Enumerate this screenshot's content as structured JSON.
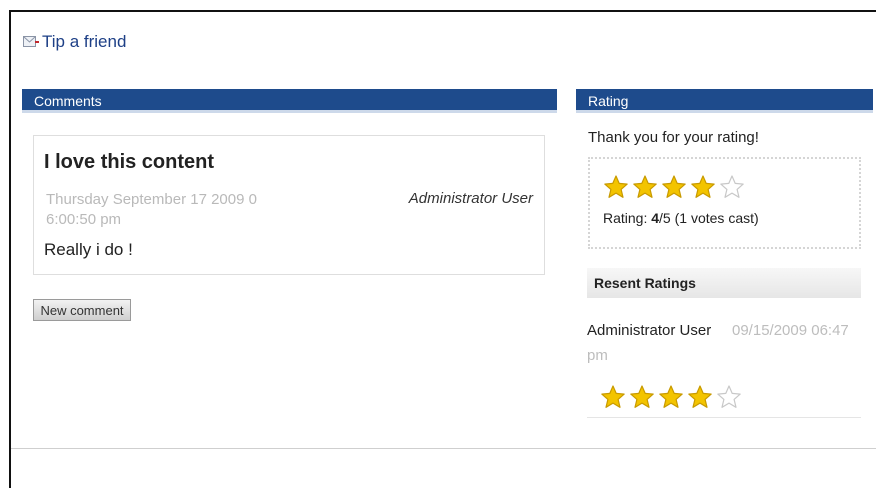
{
  "tip": {
    "label": "Tip a friend",
    "icon": "envelope-icon"
  },
  "comments": {
    "heading": "Comments",
    "items": [
      {
        "title": "I love this content",
        "date": "Thursday September 17 2009 0 6:00:50 pm",
        "author": "Administrator User",
        "body": "Really i do !"
      }
    ],
    "new_comment_label": "New comment"
  },
  "rating": {
    "heading": "Rating",
    "thanks": "Thank you for your rating!",
    "stars_filled": 4,
    "stars_total": 5,
    "label": "Rating:",
    "score": "4",
    "max": "/5",
    "votes": "(1 votes cast)"
  },
  "recent": {
    "heading": "Resent Ratings",
    "items": [
      {
        "user": "Administrator User",
        "date_line1": "09/15/2009 06:47",
        "date_line2": "pm",
        "stars_filled": 4,
        "stars_total": 5
      }
    ]
  },
  "colors": {
    "header_blue": "#1e4b8c",
    "link_blue": "#1d3f86",
    "star_gold": "#f3c400"
  }
}
